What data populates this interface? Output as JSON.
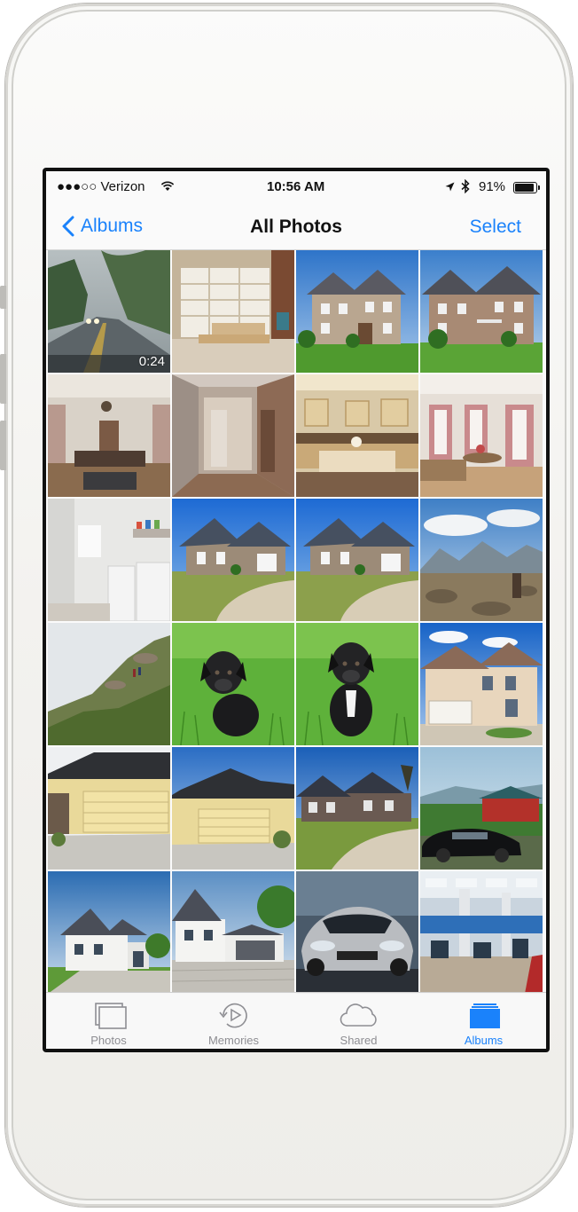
{
  "status": {
    "carrier": "●●●○○ Verizon",
    "time": "10:56 AM",
    "battery": "91%"
  },
  "nav": {
    "back_label": "Albums",
    "title": "All Photos",
    "select_label": "Select"
  },
  "photos": [
    {
      "kind": "video",
      "desc": "rainy-road",
      "duration": "0:24"
    },
    {
      "kind": "photo",
      "desc": "home-office"
    },
    {
      "kind": "photo",
      "desc": "stone-house"
    },
    {
      "kind": "photo",
      "desc": "brick-house"
    },
    {
      "kind": "photo",
      "desc": "living-room"
    },
    {
      "kind": "photo",
      "desc": "hallway"
    },
    {
      "kind": "photo",
      "desc": "kitchen"
    },
    {
      "kind": "photo",
      "desc": "dining-room"
    },
    {
      "kind": "photo",
      "desc": "laundry-room"
    },
    {
      "kind": "photo",
      "desc": "house-driveway"
    },
    {
      "kind": "photo",
      "desc": "house-driveway"
    },
    {
      "kind": "photo",
      "desc": "mountain-landscape"
    },
    {
      "kind": "photo",
      "desc": "hillside-hikers"
    },
    {
      "kind": "photo",
      "desc": "puppy"
    },
    {
      "kind": "photo",
      "desc": "puppy"
    },
    {
      "kind": "photo",
      "desc": "beige-house"
    },
    {
      "kind": "photo",
      "desc": "yellow-garage"
    },
    {
      "kind": "photo",
      "desc": "yellow-garage"
    },
    {
      "kind": "photo",
      "desc": "dark-house"
    },
    {
      "kind": "photo",
      "desc": "car-barn"
    },
    {
      "kind": "photo",
      "desc": "white-house"
    },
    {
      "kind": "photo",
      "desc": "white-house-garage"
    },
    {
      "kind": "photo",
      "desc": "sports-car"
    },
    {
      "kind": "photo",
      "desc": "office-lobby"
    }
  ],
  "tabs": [
    {
      "label": "Photos",
      "icon": "photos-icon",
      "active": false
    },
    {
      "label": "Memories",
      "icon": "memories-icon",
      "active": false
    },
    {
      "label": "Shared",
      "icon": "cloud-icon",
      "active": false
    },
    {
      "label": "Albums",
      "icon": "albums-icon",
      "active": true
    }
  ],
  "colors": {
    "accent": "#1a82fb",
    "tab_inactive": "#8e8e93"
  }
}
